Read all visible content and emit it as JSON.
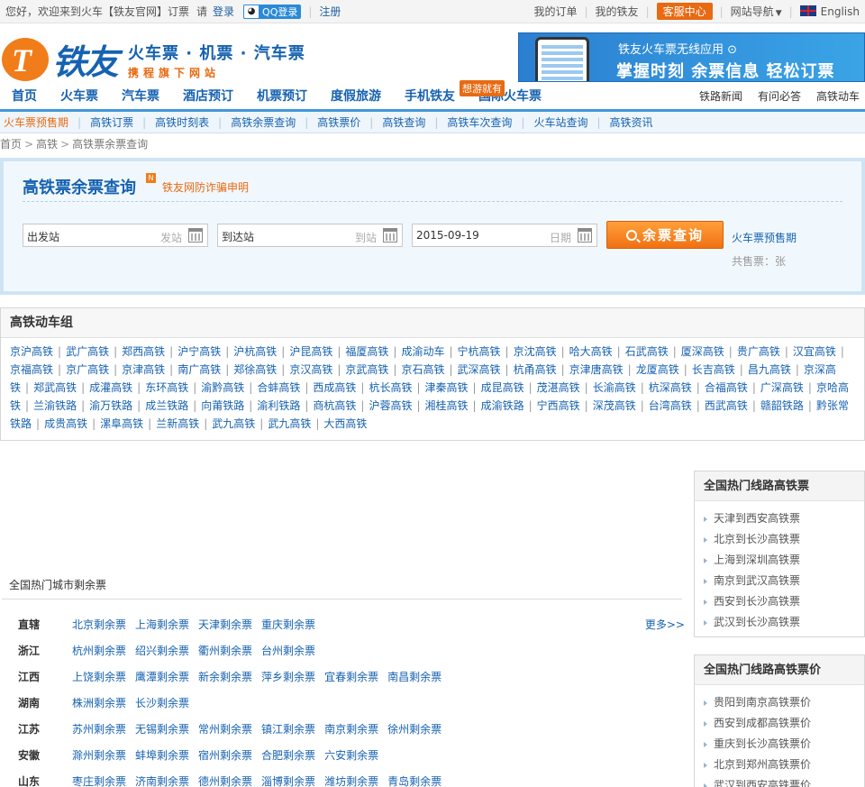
{
  "topbar": {
    "greeting": "您好，欢迎来到火车【铁友官网】订票",
    "please": "请",
    "login": "登录",
    "qq_login": "QQ登录",
    "register": "注册",
    "my_orders": "我的订单",
    "my_tieyou": "我的铁友",
    "service": "客服中心",
    "site_nav": "网站导航",
    "language": "English"
  },
  "header": {
    "logo_text": "铁友",
    "slogan_main": "火车票 · 机票 · 汽车票",
    "slogan_sub": "携程旗下网站",
    "banner_line1": "铁友火车票无线应用 ⊙",
    "banner_line2": "掌握时刻  余票信息  轻松订票"
  },
  "mainnav": {
    "items": [
      "首页",
      "火车票",
      "汽车票",
      "酒店预订",
      "机票预订",
      "度假旅游",
      "手机铁友",
      "国际火车票"
    ],
    "hot_tag": "想游就有",
    "right_links": [
      "铁路新闻",
      "有问必答",
      "高铁动车"
    ]
  },
  "subnav": {
    "items": [
      "火车票预售期",
      "高铁订票",
      "高铁时刻表",
      "高铁余票查询",
      "高铁票价",
      "高铁查询",
      "高铁车次查询",
      "火车站查询",
      "高铁资讯"
    ]
  },
  "breadcrumb": [
    "首页",
    "高铁",
    "高铁票余票查询"
  ],
  "search": {
    "title": "高铁票余票查询",
    "new_badge": "N",
    "fraud_notice": "铁友网防诈骗申明",
    "from_value": "出发站",
    "from_hint": "发站",
    "to_value": "到达站",
    "to_hint": "到站",
    "date_value": "2015-09-19",
    "date_hint": "日期",
    "button": "余票查询",
    "presale_link": "火车票预售期",
    "total": "共售票：张"
  },
  "groups": {
    "title": "高铁动车组",
    "links": [
      "京沪高铁",
      "武广高铁",
      "郑西高铁",
      "沪宁高铁",
      "沪杭高铁",
      "沪昆高铁",
      "福厦高铁",
      "成渝动车",
      "宁杭高铁",
      "京沈高铁",
      "哈大高铁",
      "石武高铁",
      "厦深高铁",
      "贵广高铁",
      "汉宜高铁",
      "京福高铁",
      "京广高铁",
      "京津高铁",
      "南广高铁",
      "郑徐高铁",
      "京汉高铁",
      "京武高铁",
      "京石高铁",
      "武深高铁",
      "杭甬高铁",
      "京津唐高铁",
      "龙厦高铁",
      "长吉高铁",
      "昌九高铁",
      "京深高铁",
      "郑武高铁",
      "成灌高铁",
      "东环高铁",
      "渝黔高铁",
      "合蚌高铁",
      "西成高铁",
      "杭长高铁",
      "津秦高铁",
      "成昆高铁",
      "茂湛高铁",
      "长渝高铁",
      "杭深高铁",
      "合福高铁",
      "广深高铁",
      "京哈高铁",
      "兰渝铁路",
      "渝万铁路",
      "成兰铁路",
      "向莆铁路",
      "渝利铁路",
      "商杭高铁",
      "沪蓉高铁",
      "湘桂高铁",
      "成渝铁路",
      "宁西高铁",
      "深茂高铁",
      "台湾高铁",
      "西武高铁",
      "赣韶铁路",
      "黔张常铁路",
      "成贵高铁",
      "漯阜高铁",
      "兰新高铁",
      "武九高铁",
      "武九高铁",
      "大西高铁"
    ]
  },
  "hot_cities": {
    "title": "全国热门城市剩余票",
    "more": "更多>>",
    "rows": [
      {
        "prov": "直辖",
        "cities": [
          "北京剩余票",
          "上海剩余票",
          "天津剩余票",
          "重庆剩余票"
        ]
      },
      {
        "prov": "浙江",
        "cities": [
          "杭州剩余票",
          "绍兴剩余票",
          "衢州剩余票",
          "台州剩余票"
        ]
      },
      {
        "prov": "江西",
        "cities": [
          "上饶剩余票",
          "鹰潭剩余票",
          "新余剩余票",
          "萍乡剩余票",
          "宜春剩余票",
          "南昌剩余票"
        ]
      },
      {
        "prov": "湖南",
        "cities": [
          "株洲剩余票",
          "长沙剩余票"
        ]
      },
      {
        "prov": "江苏",
        "cities": [
          "苏州剩余票",
          "无锡剩余票",
          "常州剩余票",
          "镇江剩余票",
          "南京剩余票",
          "徐州剩余票"
        ]
      },
      {
        "prov": "安徽",
        "cities": [
          "滁州剩余票",
          "蚌埠剩余票",
          "宿州剩余票",
          "合肥剩余票",
          "六安剩余票"
        ]
      },
      {
        "prov": "山东",
        "cities": [
          "枣庄剩余票",
          "济南剩余票",
          "德州剩余票",
          "淄博剩余票",
          "潍坊剩余票",
          "青岛剩余票"
        ]
      }
    ]
  },
  "side_routes": {
    "title": "全国热门线路高铁票",
    "items": [
      "天津到西安高铁票",
      "北京到长沙高铁票",
      "上海到深圳高铁票",
      "南京到武汉高铁票",
      "西安到长沙高铁票",
      "武汉到长沙高铁票"
    ]
  },
  "side_prices": {
    "title": "全国热门线路高铁票价",
    "items": [
      "贵阳到南京高铁票价",
      "西安到成都高铁票价",
      "重庆到长沙高铁票价",
      "北京到郑州高铁票价",
      "武汉到西安高铁票价"
    ]
  }
}
